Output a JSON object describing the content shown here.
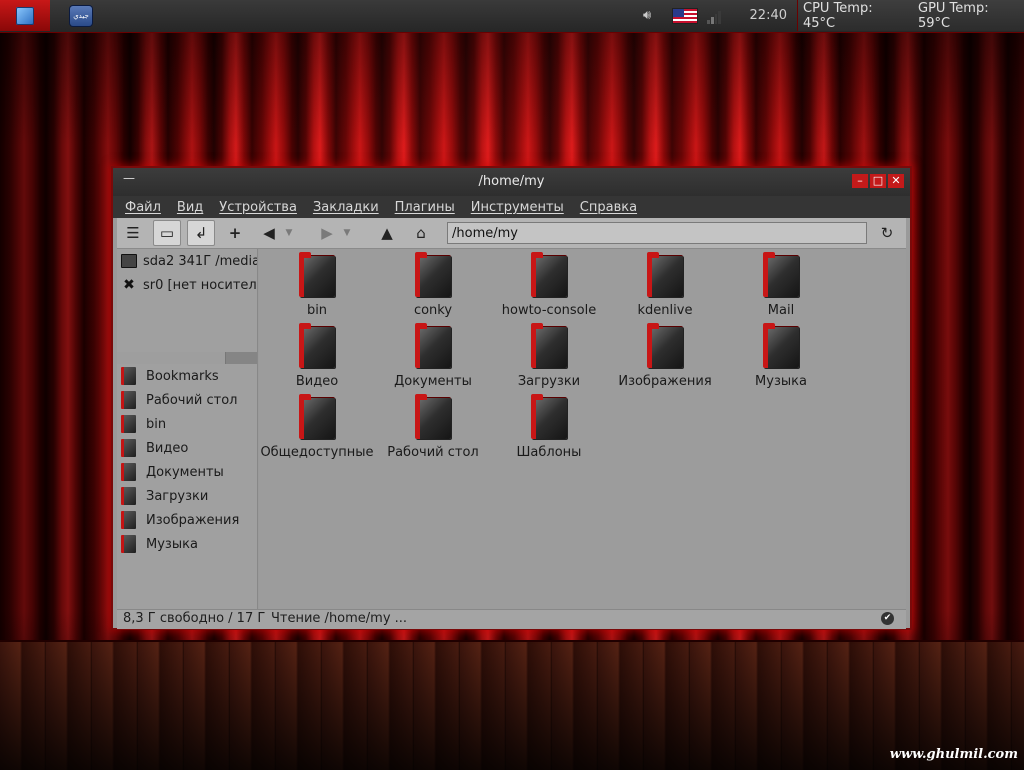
{
  "panel": {
    "quick_app_label": "جيدي",
    "clock": "22:40",
    "cpu_temp": "CPU Temp: 45°C",
    "gpu_temp": "GPU Temp: 59°C"
  },
  "window": {
    "title": "/home/my",
    "controls": {
      "minimize": "–",
      "maximize": "□",
      "close": "✕"
    }
  },
  "menubar": [
    "Файл",
    "Вид",
    "Устройства",
    "Закладки",
    "Плагины",
    "Инструменты",
    "Справка"
  ],
  "toolbar": {
    "location": "/home/my"
  },
  "sidepane": {
    "devices": [
      {
        "label": "sda2 341Г /media",
        "icon": "drive-icon"
      },
      {
        "label": "sr0 [нет носител",
        "icon": "eject-x-icon"
      }
    ],
    "bookmarks": [
      "Bookmarks",
      "Рабочий стол",
      "bin",
      "Видео",
      "Документы",
      "Загрузки",
      "Изображения",
      "Музыка"
    ]
  },
  "files": [
    "bin",
    "conky",
    "howto-console",
    "kdenlive",
    "Mail",
    "Видео",
    "Документы",
    "Загрузки",
    "Изображения",
    "Музыка",
    "Общедоступные",
    "Рабочий стол",
    "Шаблоны"
  ],
  "status": {
    "free_space": "8,3 Г свободно / 17 Г",
    "message": "Чтение /home/my ..."
  },
  "watermark": "www.ghulmil.com",
  "colors": {
    "accent": "#c41414",
    "panel": "#2e2e2e",
    "window_bg": "#9c9c9c"
  }
}
